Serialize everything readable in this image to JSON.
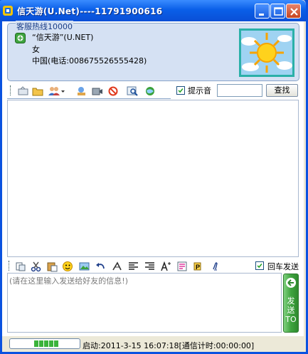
{
  "window": {
    "title": "信天游(U.Net)----11791900616",
    "controls": [
      "minimize",
      "maximize",
      "close"
    ]
  },
  "contact": {
    "hotline": "客服热线10000",
    "name": "“信天游”(U.NET)",
    "gender": "女",
    "location": "中国(电话:008675526555428)",
    "status_icon": "online-status-icon",
    "avatar": "sun-avatar"
  },
  "toolbar_top": {
    "icons": [
      "send-file-icon",
      "folder-icon",
      "add-contact-icon",
      "user-info-icon",
      "video-icon",
      "block-icon",
      "search-history-icon",
      "web-icon"
    ],
    "sound_prompt_label": "提示音",
    "sound_prompt_checked": true,
    "search_value": "",
    "find_label": "查找"
  },
  "toolbar_bottom": {
    "icons": [
      "copy-icon",
      "cut-icon",
      "paste-icon",
      "emoticon-icon",
      "screenshot-icon",
      "undo-icon",
      "clear-icon",
      "align-left-icon",
      "align-right-icon",
      "font-icon",
      "color-icon",
      "bold-icon",
      "clip-icon"
    ],
    "enter_send_label": "回车发送",
    "enter_send_checked": true
  },
  "message": {
    "placeholder": "(请在这里输入发送给好友的信息!)",
    "send_label": "发送TO"
  },
  "status": {
    "progress_segments": 5,
    "text": "启动:2011-3-15 16:07:18[通信计时:00:00:00]"
  }
}
